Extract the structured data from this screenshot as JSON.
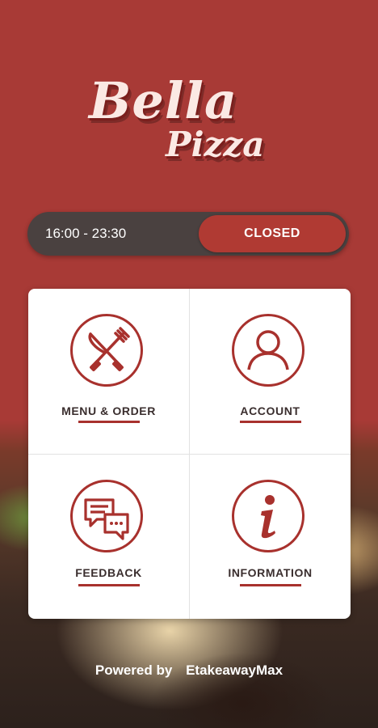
{
  "brand": {
    "line1": "Bella",
    "line2": "Pizza"
  },
  "hours": {
    "text": "16:00 - 23:30",
    "status": "CLOSED"
  },
  "tiles": [
    {
      "label": "MENU & ORDER",
      "icon": "cutlery-icon"
    },
    {
      "label": "ACCOUNT",
      "icon": "user-icon"
    },
    {
      "label": "FEEDBACK",
      "icon": "chat-bubbles-icon"
    },
    {
      "label": "INFORMATION",
      "icon": "info-icon"
    }
  ],
  "footer": {
    "powered_by": "Powered by",
    "provider": "EtakeawayMax"
  },
  "colors": {
    "brand_red": "#a83a36",
    "accent": "#a8312d",
    "bar_dark": "#4a4140"
  }
}
